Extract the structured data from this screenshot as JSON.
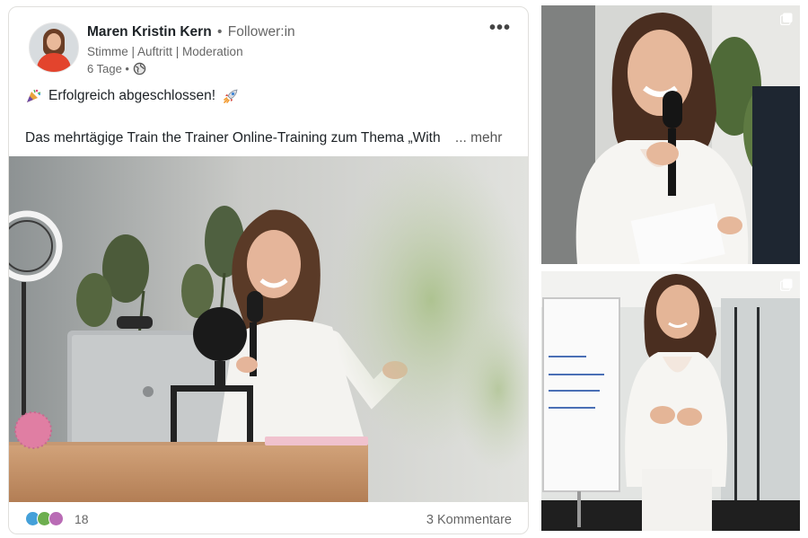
{
  "post": {
    "author_name": "Maren Kristin Kern",
    "separator": "•",
    "follower_label": "Follower:in",
    "headline": "Stimme | Auftritt | Moderation",
    "timestamp": "6 Tage •",
    "visibility_icon": "globe-icon",
    "more_menu": "•••",
    "line1": "Erfolgreich abgeschlossen!",
    "line1_icons": [
      "party-popper-icon",
      "rocket-icon"
    ],
    "line2": "Das mehrtägige Train the Trainer Online-Training zum Thema „With",
    "see_more": "... mehr",
    "reaction_count": "18",
    "comments": "3 Kommentare"
  },
  "side_photos": [
    {
      "icon": "multi-image-icon"
    },
    {
      "icon": "multi-image-icon"
    }
  ],
  "colors": {
    "accent": "#0a66c2",
    "text_muted": "#666666",
    "blazer": "#f4f3f0"
  }
}
